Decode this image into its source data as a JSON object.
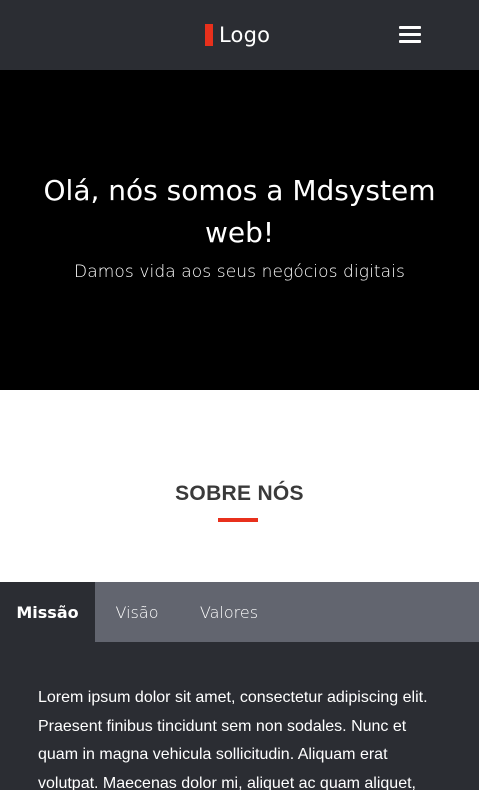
{
  "navbar": {
    "logo_text": "Logo",
    "menu_icon": "hamburger-menu-icon"
  },
  "hero": {
    "title": "Olá, nós somos a Mdsystem web!",
    "subtitle": "Damos vida aos seus negócios digitais"
  },
  "about": {
    "title": "SOBRE NÓS"
  },
  "tabs": {
    "items": [
      {
        "label": "Missão",
        "active": true
      },
      {
        "label": "Visão",
        "active": false
      },
      {
        "label": "Valores",
        "active": false
      }
    ]
  },
  "content": {
    "text": "Lorem ipsum dolor sit amet, consectetur adipiscing elit. Praesent finibus tincidunt sem non sodales. Nunc et quam in magna vehicula sollicitudin. Aliquam erat volutpat. Maecenas dolor mi, aliquet ac quam aliquet,"
  },
  "colors": {
    "accent": "#e8301c",
    "navbar_bg": "#2b2d33",
    "hero_bg": "#000000",
    "tabs_bg": "#62656f",
    "content_bg": "#2b2d33"
  }
}
